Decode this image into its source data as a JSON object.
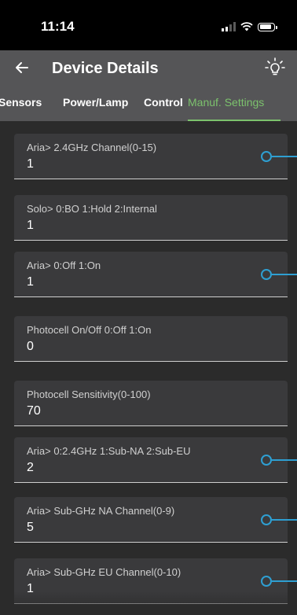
{
  "status_bar": {
    "time": "11:14"
  },
  "app_bar": {
    "title": "Device Details",
    "back_icon": "arrow-left-icon",
    "action_icon": "lightbulb-icon"
  },
  "tabs": [
    {
      "label": "Sensors",
      "active": false
    },
    {
      "label": "Power/Lamp",
      "active": false
    },
    {
      "label": "Control",
      "active": false
    },
    {
      "label": "Manuf. Settings",
      "active": true
    }
  ],
  "colors": {
    "accent": "#7cc26d",
    "connector": "#2e9fd2",
    "app_bar": "#555557",
    "field_bg": "#3a3a3c"
  },
  "fields": [
    {
      "label": "Aria> 2.4GHz Channel(0-15)",
      "value": "1",
      "connector": true
    },
    {
      "label": "Solo> 0:BO 1:Hold 2:Internal",
      "value": "1",
      "connector": false
    },
    {
      "label": "Aria> 0:Off 1:On",
      "value": "1",
      "connector": true
    },
    {
      "label": "Photocell On/Off 0:Off 1:On",
      "value": "0",
      "connector": false
    },
    {
      "label": "Photocell Sensitivity(0-100)",
      "value": "70",
      "connector": false
    },
    {
      "label": "Aria> 0:2.4GHz 1:Sub-NA 2:Sub-EU",
      "value": "2",
      "connector": true
    },
    {
      "label": "Aria> Sub-GHz NA Channel(0-9)",
      "value": "5",
      "connector": true
    },
    {
      "label": "Aria> Sub-GHz EU Channel(0-10)",
      "value": "1",
      "connector": true
    }
  ]
}
